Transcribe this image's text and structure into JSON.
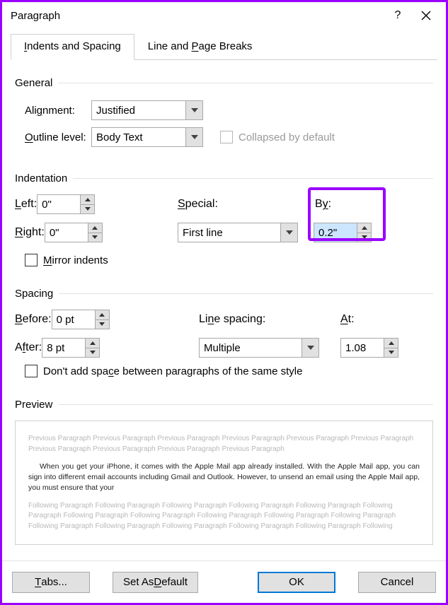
{
  "title": "Paragraph",
  "tabs": {
    "indents": "Indents and Spacing",
    "breaks": "Line and Page Breaks"
  },
  "sections": {
    "general": "General",
    "indentation": "Indentation",
    "spacing": "Spacing",
    "preview": "Preview"
  },
  "general": {
    "alignment_label": "Alignment:",
    "alignment_value": "Justified",
    "outline_label": "Outline level:",
    "outline_value": "Body Text",
    "collapsed_label": "Collapsed by default"
  },
  "indentation": {
    "left_label": "Left:",
    "left_value": "0\"",
    "right_label": "Right:",
    "right_value": "0\"",
    "special_label": "Special:",
    "special_value": "First line",
    "by_label": "By:",
    "by_value": "0.2\"",
    "mirror_label": "Mirror indents"
  },
  "spacing": {
    "before_label": "Before:",
    "before_value": "0 pt",
    "after_label": "After:",
    "after_value": "8 pt",
    "line_label": "Line spacing:",
    "line_value": "Multiple",
    "at_label": "At:",
    "at_value": "1.08",
    "noadd_label": "Don't add space between paragraphs of the same style"
  },
  "preview": {
    "prev": "Previous Paragraph Previous Paragraph Previous Paragraph Previous Paragraph Previous Paragraph Previous Paragraph Previous Paragraph Previous Paragraph Previous Paragraph Previous Paragraph",
    "main": "When you get your iPhone, it comes with the Apple Mail app already installed. With the Apple Mail app, you can sign into different email accounts including Gmail and Outlook. However, to unsend an email using the Apple Mail app, you must ensure that your",
    "next": "Following Paragraph Following Paragraph Following Paragraph Following Paragraph Following Paragraph Following Paragraph Following Paragraph Following Paragraph Following Paragraph Following Paragraph Following Paragraph Following Paragraph Following Paragraph Following Paragraph Following Paragraph Following Paragraph Following"
  },
  "buttons": {
    "tabs": "Tabs...",
    "default": "Set As Default",
    "ok": "OK",
    "cancel": "Cancel"
  }
}
